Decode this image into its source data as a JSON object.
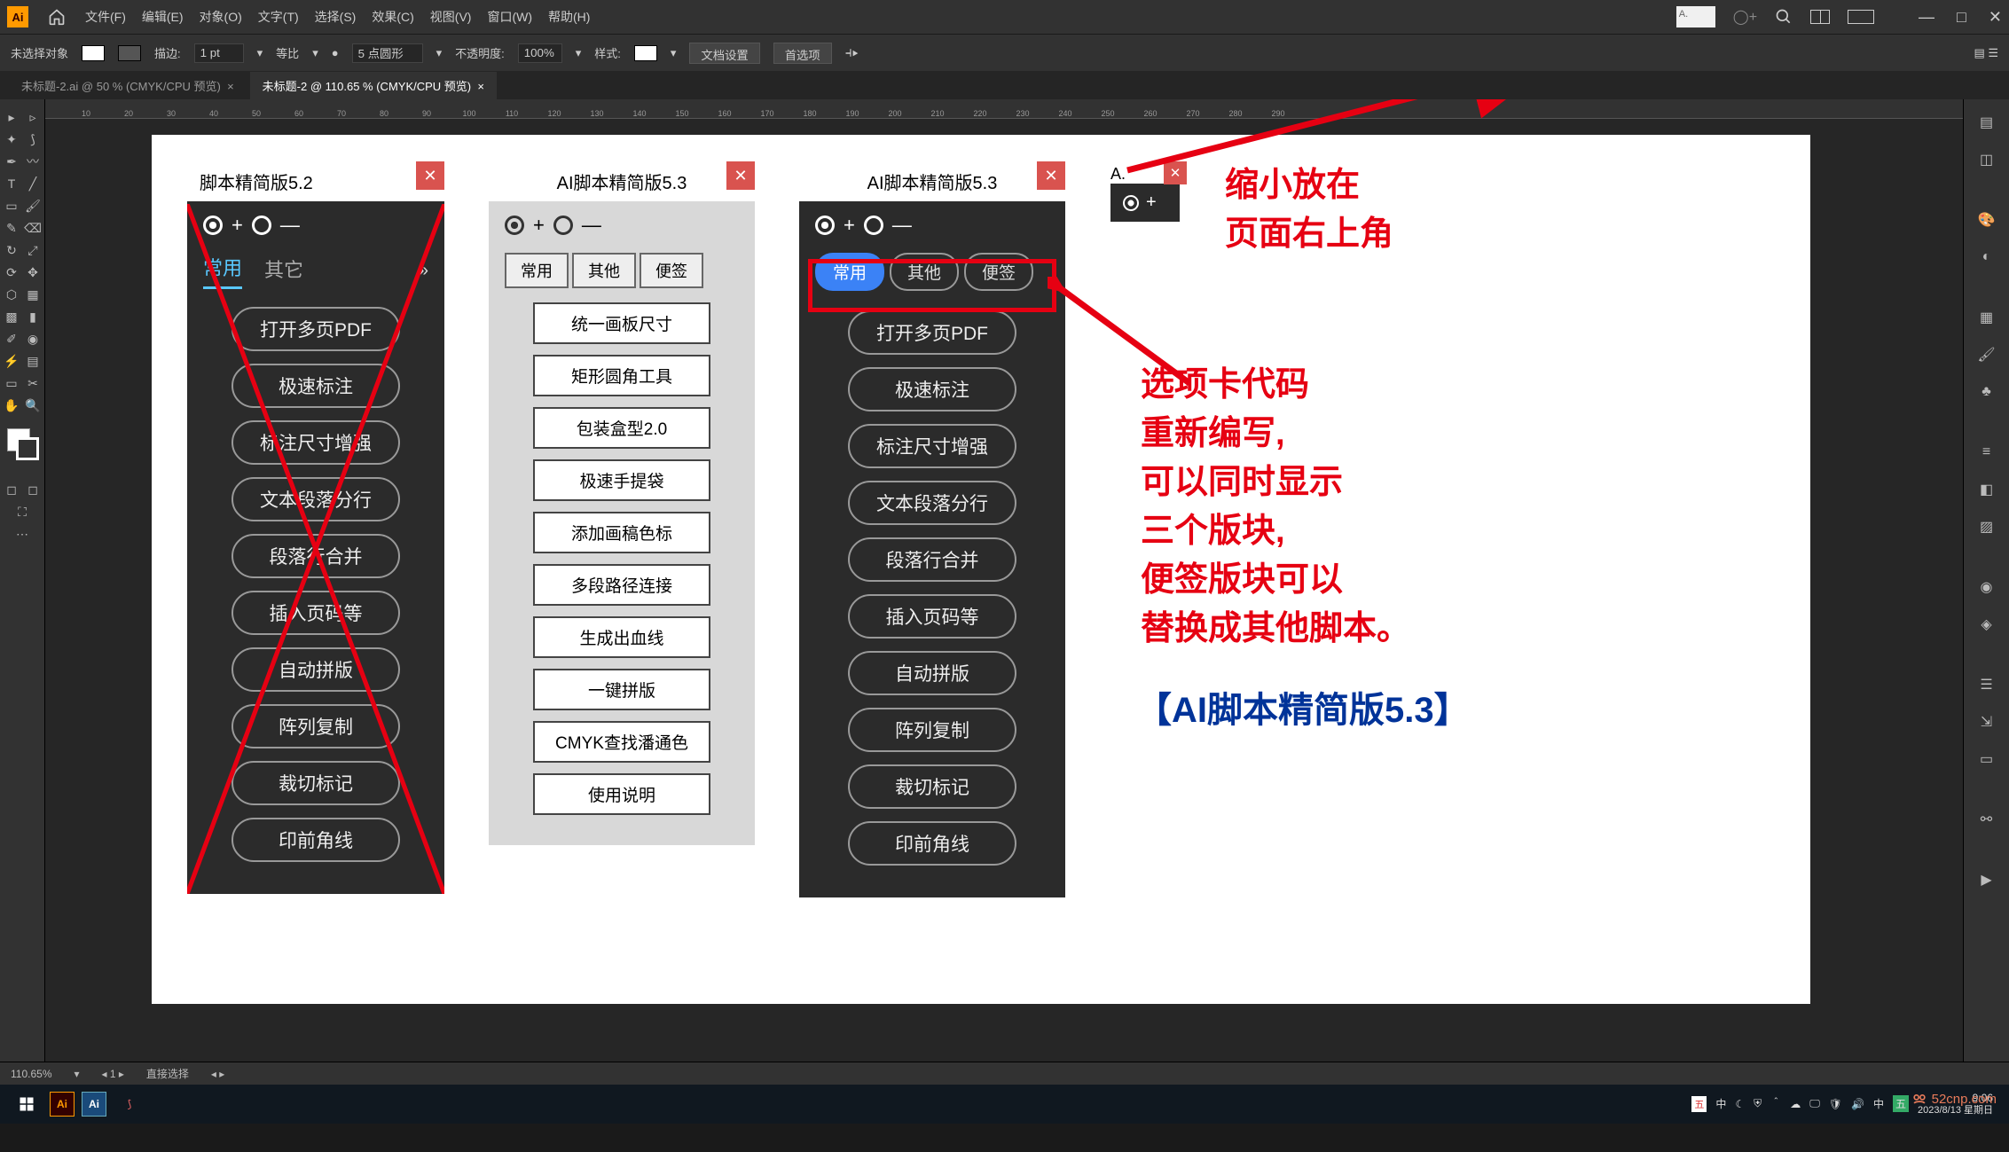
{
  "menubar": {
    "items": [
      "文件(F)",
      "编辑(E)",
      "对象(O)",
      "文字(T)",
      "选择(S)",
      "效果(C)",
      "视图(V)",
      "窗口(W)",
      "帮助(H)"
    ]
  },
  "searchbox_text": "A.",
  "controlbar": {
    "nosel": "未选择对象",
    "stroke_label": "描边:",
    "stroke_val": "1 pt",
    "uniform": "等比",
    "points": "5 点圆形",
    "opacity_label": "不透明度:",
    "opacity_val": "100%",
    "style_label": "样式:",
    "btn1": "文档设置",
    "btn2": "首选项"
  },
  "tabs": {
    "t1": "未标题-2.ai @ 50 % (CMYK/CPU 预览)",
    "t2": "未标题-2 @ 110.65 % (CMYK/CPU 预览)"
  },
  "ruler_ticks": [
    "10",
    "20",
    "30",
    "40",
    "50",
    "60",
    "70",
    "80",
    "90",
    "100",
    "110",
    "120",
    "130",
    "140",
    "150",
    "160",
    "170",
    "180",
    "190",
    "200",
    "210",
    "220",
    "230",
    "240",
    "250",
    "260",
    "270",
    "280",
    "290"
  ],
  "panel52": {
    "title": "脚本精简版5.2",
    "tabs": [
      "常用",
      "其它"
    ],
    "buttons": [
      "打开多页PDF",
      "极速标注",
      "标注尺寸增强",
      "文本段落分行",
      "段落行合并",
      "插入页码等",
      "自动拼版",
      "阵列复制",
      "裁切标记",
      "印前角线"
    ]
  },
  "panel53light": {
    "title": "AI脚本精简版5.3",
    "tabs": [
      "常用",
      "其他",
      "便签"
    ],
    "buttons": [
      "统一画板尺寸",
      "矩形圆角工具",
      "包装盒型2.0",
      "极速手提袋",
      "添加画稿色标",
      "多段路径连接",
      "生成出血线",
      "一键拼版",
      "CMYK查找潘通色",
      "使用说明"
    ]
  },
  "panel53dark": {
    "title": "AI脚本精简版5.3",
    "tabs": [
      "常用",
      "其他",
      "便签"
    ],
    "buttons": [
      "打开多页PDF",
      "极速标注",
      "标注尺寸增强",
      "文本段落分行",
      "段落行合并",
      "插入页码等",
      "自动拼版",
      "阵列复制",
      "裁切标记",
      "印前角线"
    ]
  },
  "mini": {
    "title": "A."
  },
  "annot1_l1": "缩小放在",
  "annot1_l2": "页面右上角",
  "annot2_l1": "选项卡代码",
  "annot2_l2": "重新编写,",
  "annot2_l3": "可以同时显示",
  "annot2_l4": "三个版块,",
  "annot2_l5": "便签版块可以",
  "annot2_l6": "替换成其他脚本。",
  "annot3": "【AI脚本精简版5.3】",
  "status": {
    "zoom": "110.65%",
    "tool": "直接选择"
  },
  "clock": {
    "time": "9:06",
    "date": "2023/8/13 星期日"
  },
  "watermark": "52cnp.com",
  "ime": "中"
}
